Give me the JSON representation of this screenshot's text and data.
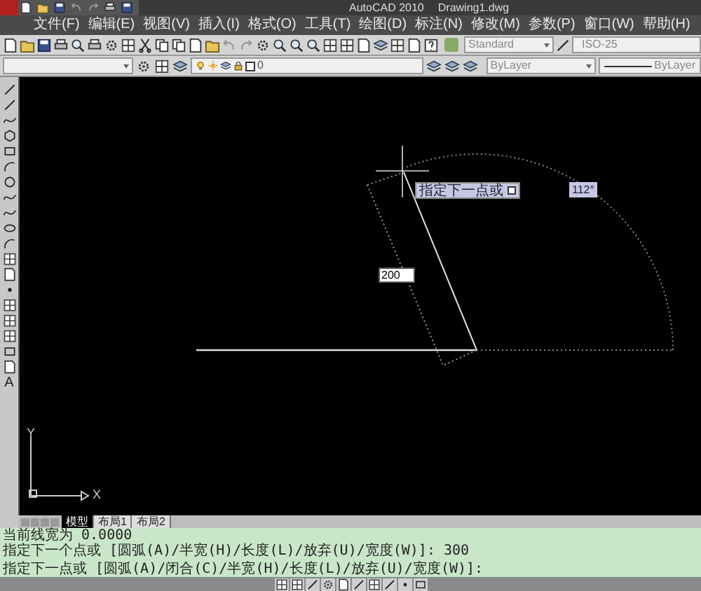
{
  "window": {
    "app_title": "AutoCAD 2010",
    "document_title": "Drawing1.dwg"
  },
  "menu": [
    "文件(F)",
    "编辑(E)",
    "视图(V)",
    "插入(I)",
    "格式(O)",
    "工具(T)",
    "绘图(D)",
    "标注(N)",
    "修改(M)",
    "参数(P)",
    "窗口(W)",
    "帮助(H)"
  ],
  "styles_toolbar": {
    "text_style": "Standard",
    "dimension_style": "ISO-25"
  },
  "layers_toolbar": {
    "layer": "0",
    "color_setting": "ByLayer",
    "linetype": "ByLayer"
  },
  "left_toolbar": {
    "text_tool": "A"
  },
  "canvas": {
    "prompt_tooltip": "指定下一点或",
    "angle_tooltip": "112°",
    "length_input": "200",
    "ucs_y": "Y",
    "ucs_x": "X"
  },
  "layout_tabs": [
    {
      "label": "模型",
      "selected": true
    },
    {
      "label": "布局1",
      "selected": false
    },
    {
      "label": "布局2",
      "selected": false
    }
  ],
  "command_lines": [
    "当前线宽为 0.0000",
    "指定下一个点或 [圆弧(A)/半宽(H)/长度(L)/放弃(U)/宽度(W)]: 300",
    "指定下一点或 [圆弧(A)/闭合(C)/半宽(H)/长度(L)/放弃(U)/宽度(W)]:"
  ]
}
